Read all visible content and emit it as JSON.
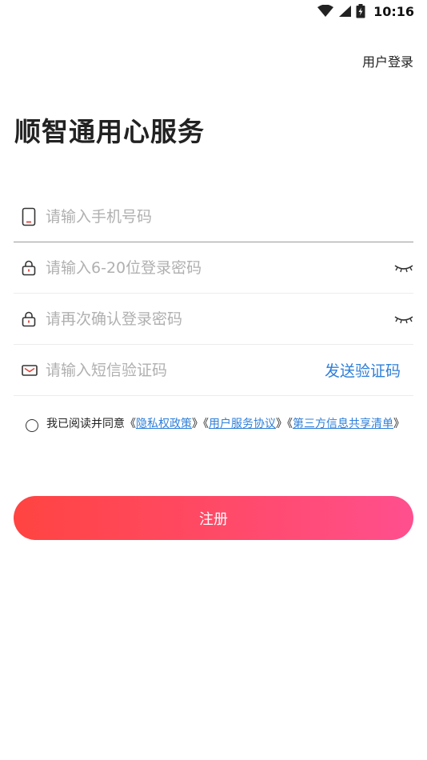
{
  "status_bar": {
    "time": "10:16",
    "icons": [
      "wifi-icon",
      "cellular-signal-icon",
      "battery-icon"
    ]
  },
  "header": {
    "login_link": "用户登录"
  },
  "title": "顺智通用心服务",
  "form": {
    "phone_placeholder": "请输入手机号码",
    "password_placeholder": "请输入6-20位登录密码",
    "confirm_placeholder": "请再次确认登录密码",
    "code_placeholder": "请输入短信验证码",
    "send_code_label": "发送验证码",
    "icons": [
      "phone-icon",
      "lock-icon",
      "lock-icon",
      "mail-icon",
      "eye-closed-icon"
    ]
  },
  "agreement": {
    "prefix": "我已阅读并同意",
    "open_quote": "《",
    "close_quote": "》",
    "privacy_policy": "隐私权政策",
    "service_agreement": "用户服务协议",
    "third_party_list": "第三方信息共享清单"
  },
  "register_label": "注册",
  "colors": {
    "accent_blue": "#2f7fd9",
    "button_gradient_start": "#ff4441",
    "button_gradient_end": "#ff4f8e",
    "icon_red": "#e0453c"
  }
}
